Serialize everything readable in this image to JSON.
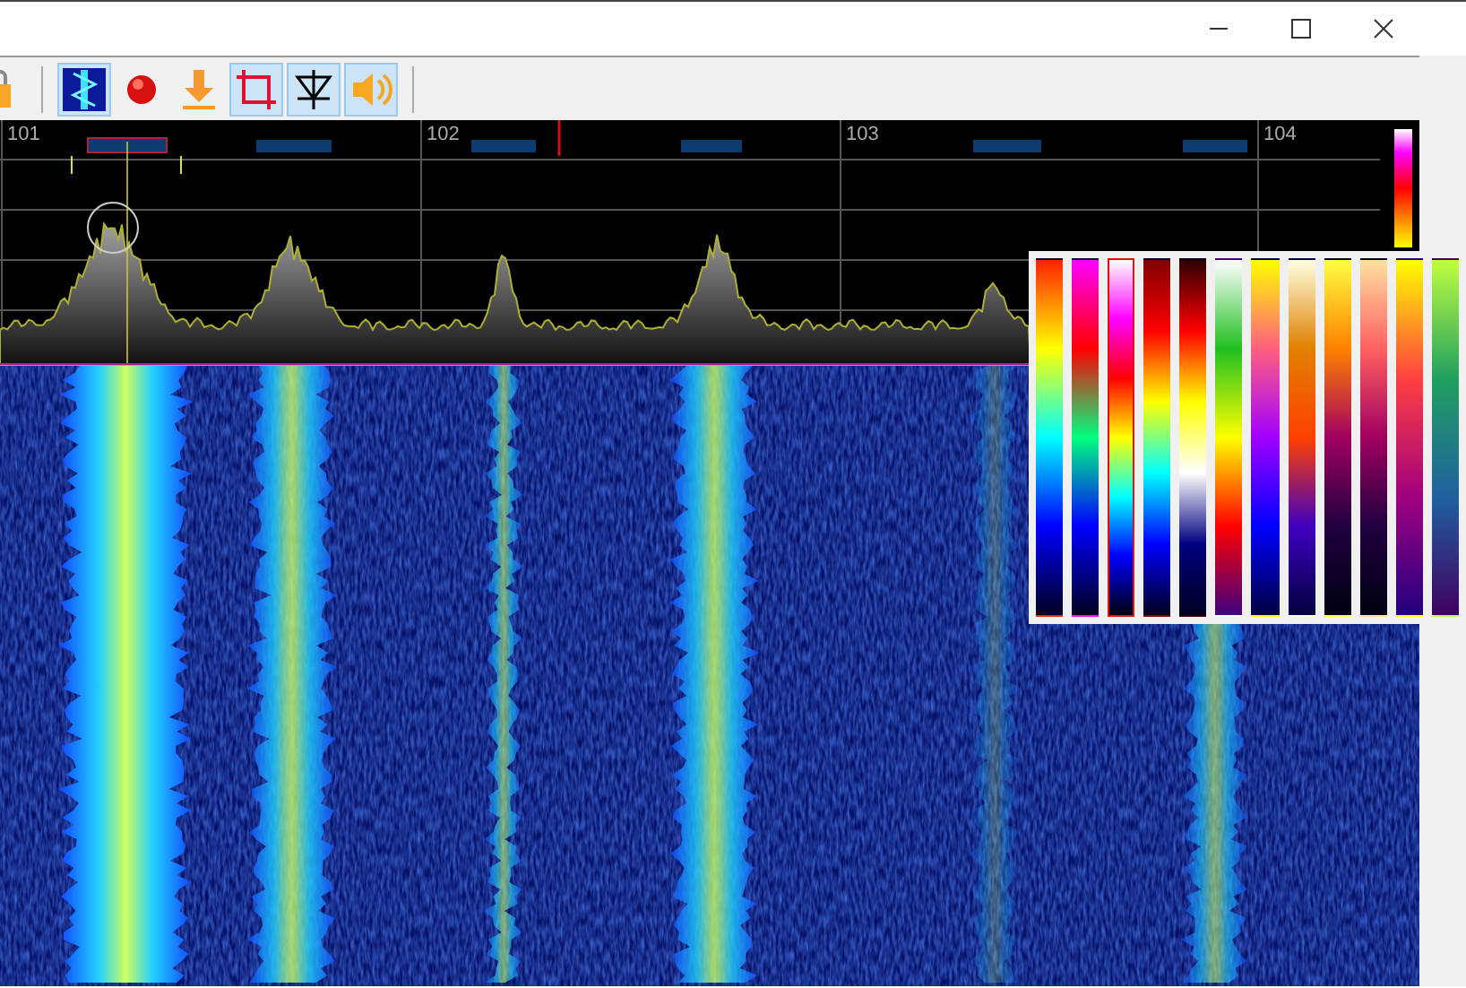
{
  "toolbar": {
    "items": [
      {
        "kind": "waterfall",
        "selected": true
      },
      {
        "kind": "record",
        "selected": false
      },
      {
        "kind": "download",
        "selected": false
      },
      {
        "kind": "crop",
        "selected": true
      },
      {
        "kind": "diode",
        "selected": true
      },
      {
        "kind": "speaker",
        "selected": true
      }
    ]
  },
  "spectrum": {
    "frequency_labels": [
      "101",
      "102",
      "103",
      "104"
    ]
  },
  "palette_popup": {
    "palettes": [
      {
        "selected": false
      },
      {
        "selected": false
      },
      {
        "selected": true
      },
      {
        "selected": false
      },
      {
        "selected": false
      },
      {
        "selected": false
      },
      {
        "selected": false
      },
      {
        "selected": false
      },
      {
        "selected": false
      },
      {
        "selected": false
      },
      {
        "selected": false
      },
      {
        "selected": false
      }
    ]
  }
}
